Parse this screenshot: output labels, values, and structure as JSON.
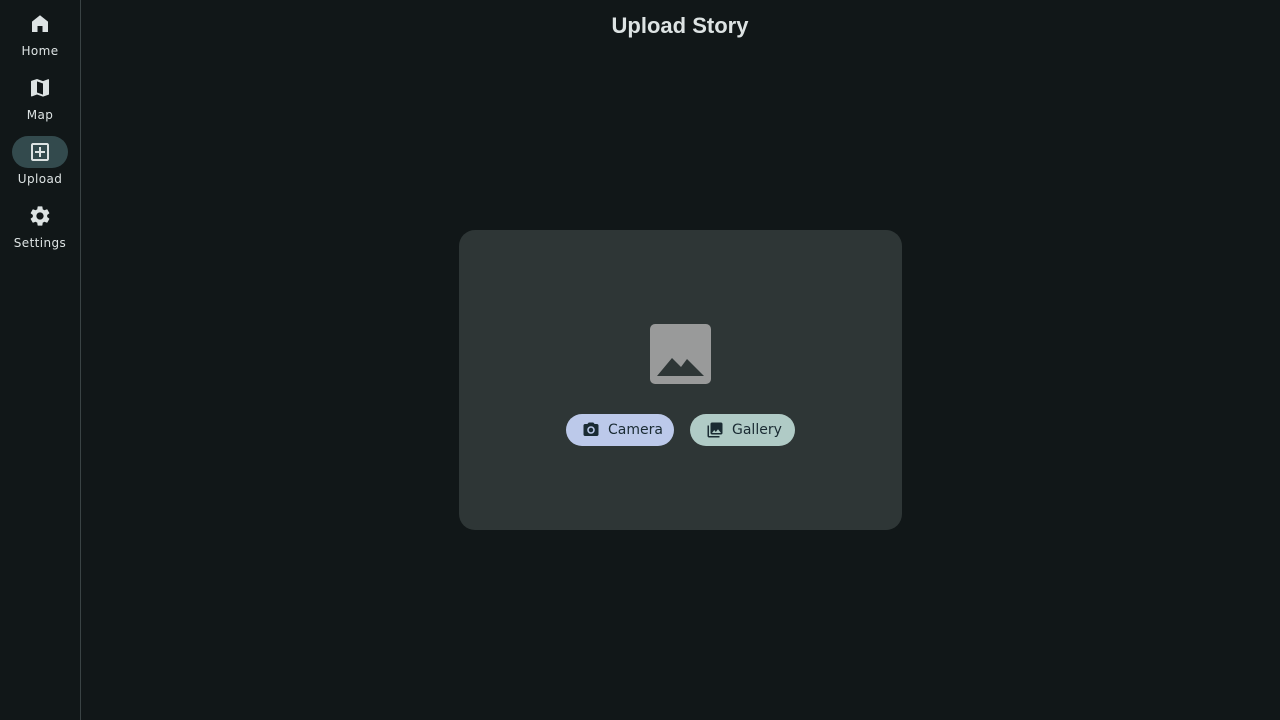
{
  "nav": {
    "items": [
      {
        "label": "Home",
        "icon": "home-icon",
        "active": false
      },
      {
        "label": "Map",
        "icon": "map-icon",
        "active": false
      },
      {
        "label": "Upload",
        "icon": "add-box-icon",
        "active": true
      },
      {
        "label": "Settings",
        "icon": "gear-icon",
        "active": false
      }
    ]
  },
  "header": {
    "title": "Upload Story"
  },
  "upload": {
    "placeholder_icon": "image-placeholder-icon",
    "camera_label": "Camera",
    "camera_icon": "camera-icon",
    "gallery_label": "Gallery",
    "gallery_icon": "gallery-icon"
  },
  "colors": {
    "background": "#111718",
    "surface": "#2e3636",
    "active_indicator": "#334a4d",
    "camera_button": "#bcc9ea",
    "gallery_button": "#b0cbc6"
  }
}
